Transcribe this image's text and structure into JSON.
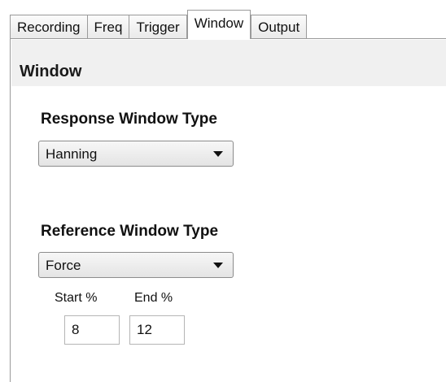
{
  "tabs": [
    {
      "label": "Recording"
    },
    {
      "label": "Freq"
    },
    {
      "label": "Trigger"
    },
    {
      "label": "Window"
    },
    {
      "label": "Output"
    }
  ],
  "active_tab": "Window",
  "panel": {
    "title": "Window",
    "response_window": {
      "label": "Response Window Type",
      "selected": "Hanning"
    },
    "reference_window": {
      "label": "Reference Window Type",
      "selected": "Force",
      "start_label": "Start %",
      "end_label": "End %",
      "start_value": "8",
      "end_value": "12"
    }
  },
  "colors": {
    "header_background": "#f0f0f0",
    "border": "#9a9a9a"
  }
}
